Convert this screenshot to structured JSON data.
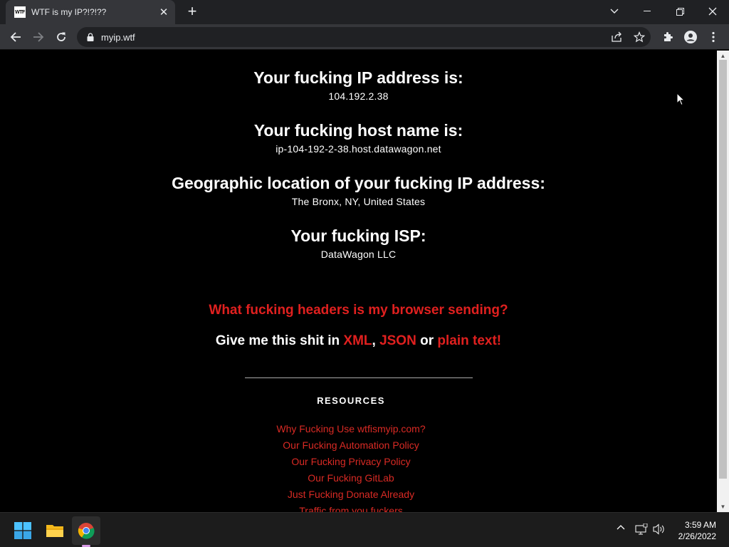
{
  "browser": {
    "tab_title": "WTF is my IP?!?!??",
    "favicon_text": "WTF",
    "url": "myip.wtf"
  },
  "page": {
    "ip_heading": "Your fucking IP address is:",
    "ip_value": "104.192.2.38",
    "host_heading": "Your fucking host name is:",
    "host_value": "ip-104-192-2-38.host.datawagon.net",
    "geo_heading": "Geographic location of your fucking IP address:",
    "geo_value": "The Bronx, NY, United States",
    "isp_heading": "Your fucking ISP:",
    "isp_value": "DataWagon LLC",
    "headers_link": "What fucking headers is my browser sending?",
    "formats_prefix": "Give me this shit in ",
    "format_xml": "XML",
    "format_sep1": ", ",
    "format_json": "JSON",
    "format_sep2": " or ",
    "format_plain": "plain text!",
    "resources_title": "RESOURCES",
    "resources": [
      "Why Fucking Use wtfismyip.com?",
      "Our Fucking Automation Policy",
      "Our Fucking Privacy Policy",
      "Our Fucking GitLab",
      "Just Fucking Donate Already",
      "Traffic from you fuckers"
    ]
  },
  "taskbar": {
    "time": "3:59 AM",
    "date": "2/26/2022"
  },
  "colors": {
    "accent_red": "#e0201f",
    "page_bg": "#000000",
    "chrome_dark": "#202124",
    "chrome_toolbar": "#35363a"
  },
  "icons": [
    "windows-start-icon",
    "file-explorer-icon",
    "chrome-icon",
    "lock-icon",
    "share-icon",
    "star-icon",
    "extensions-icon",
    "profile-icon",
    "menu-icon",
    "back-icon",
    "forward-icon",
    "reload-icon"
  ]
}
